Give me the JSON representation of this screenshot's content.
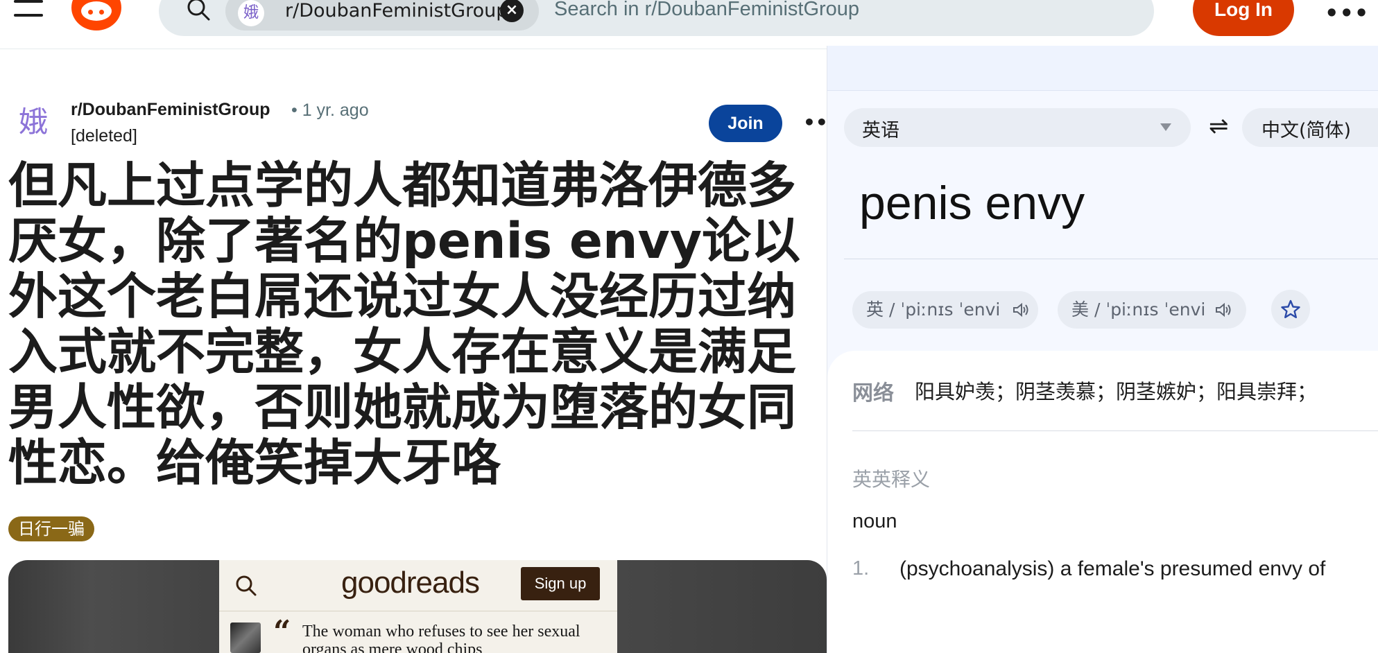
{
  "header": {
    "search_chip_avatar": "娥",
    "search_chip_label": "r/DoubanFeministGroup",
    "search_chip_clear": "×",
    "search_placeholder": "Search in r/DoubanFeministGroup",
    "login_label": "Log In",
    "more": "•••",
    "brand_color": "#ff4500"
  },
  "post": {
    "avatar_glyph": "娥",
    "subreddit": "r/DoubanFeministGroup",
    "time": "• 1 yr. ago",
    "author": "[deleted]",
    "join_label": "Join",
    "more": "•••",
    "title": "但凡上过点学的人都知道弗洛伊德多厌女，除了著名的penis envy论以外这个老白屌还说过女人没经历过纳入式就不完整，女人存在意义是满足男人性欲，否则她就成为堕落的女同性恋。给俺笑掉大牙咯",
    "flair": "日行一骗"
  },
  "embed": {
    "logo_thin": "good",
    "logo_bold": "reads",
    "signup_label": "Sign up",
    "quote_mark": "“",
    "quote_text": "The woman who refuses to see her sexual organs as mere wood chips"
  },
  "translator": {
    "source_lang": "英语",
    "swap_icon": "⇌",
    "target_lang": "中文(简体)",
    "query": "penis envy",
    "uk_phonetic": "英 / ˈpiːnɪs ˈenvi",
    "us_phonetic": "美 / ˈpiːnɪs ˈenvi",
    "web_label": "网络",
    "web_translations": "阳具妒羡；阴茎羡慕；阴茎嫉妒；阳具崇拜；",
    "en_en_label": "英英释义",
    "part_of_speech": "noun",
    "definition_number": "1.",
    "definition": "(psychoanalysis) a female's presumed envy of"
  }
}
